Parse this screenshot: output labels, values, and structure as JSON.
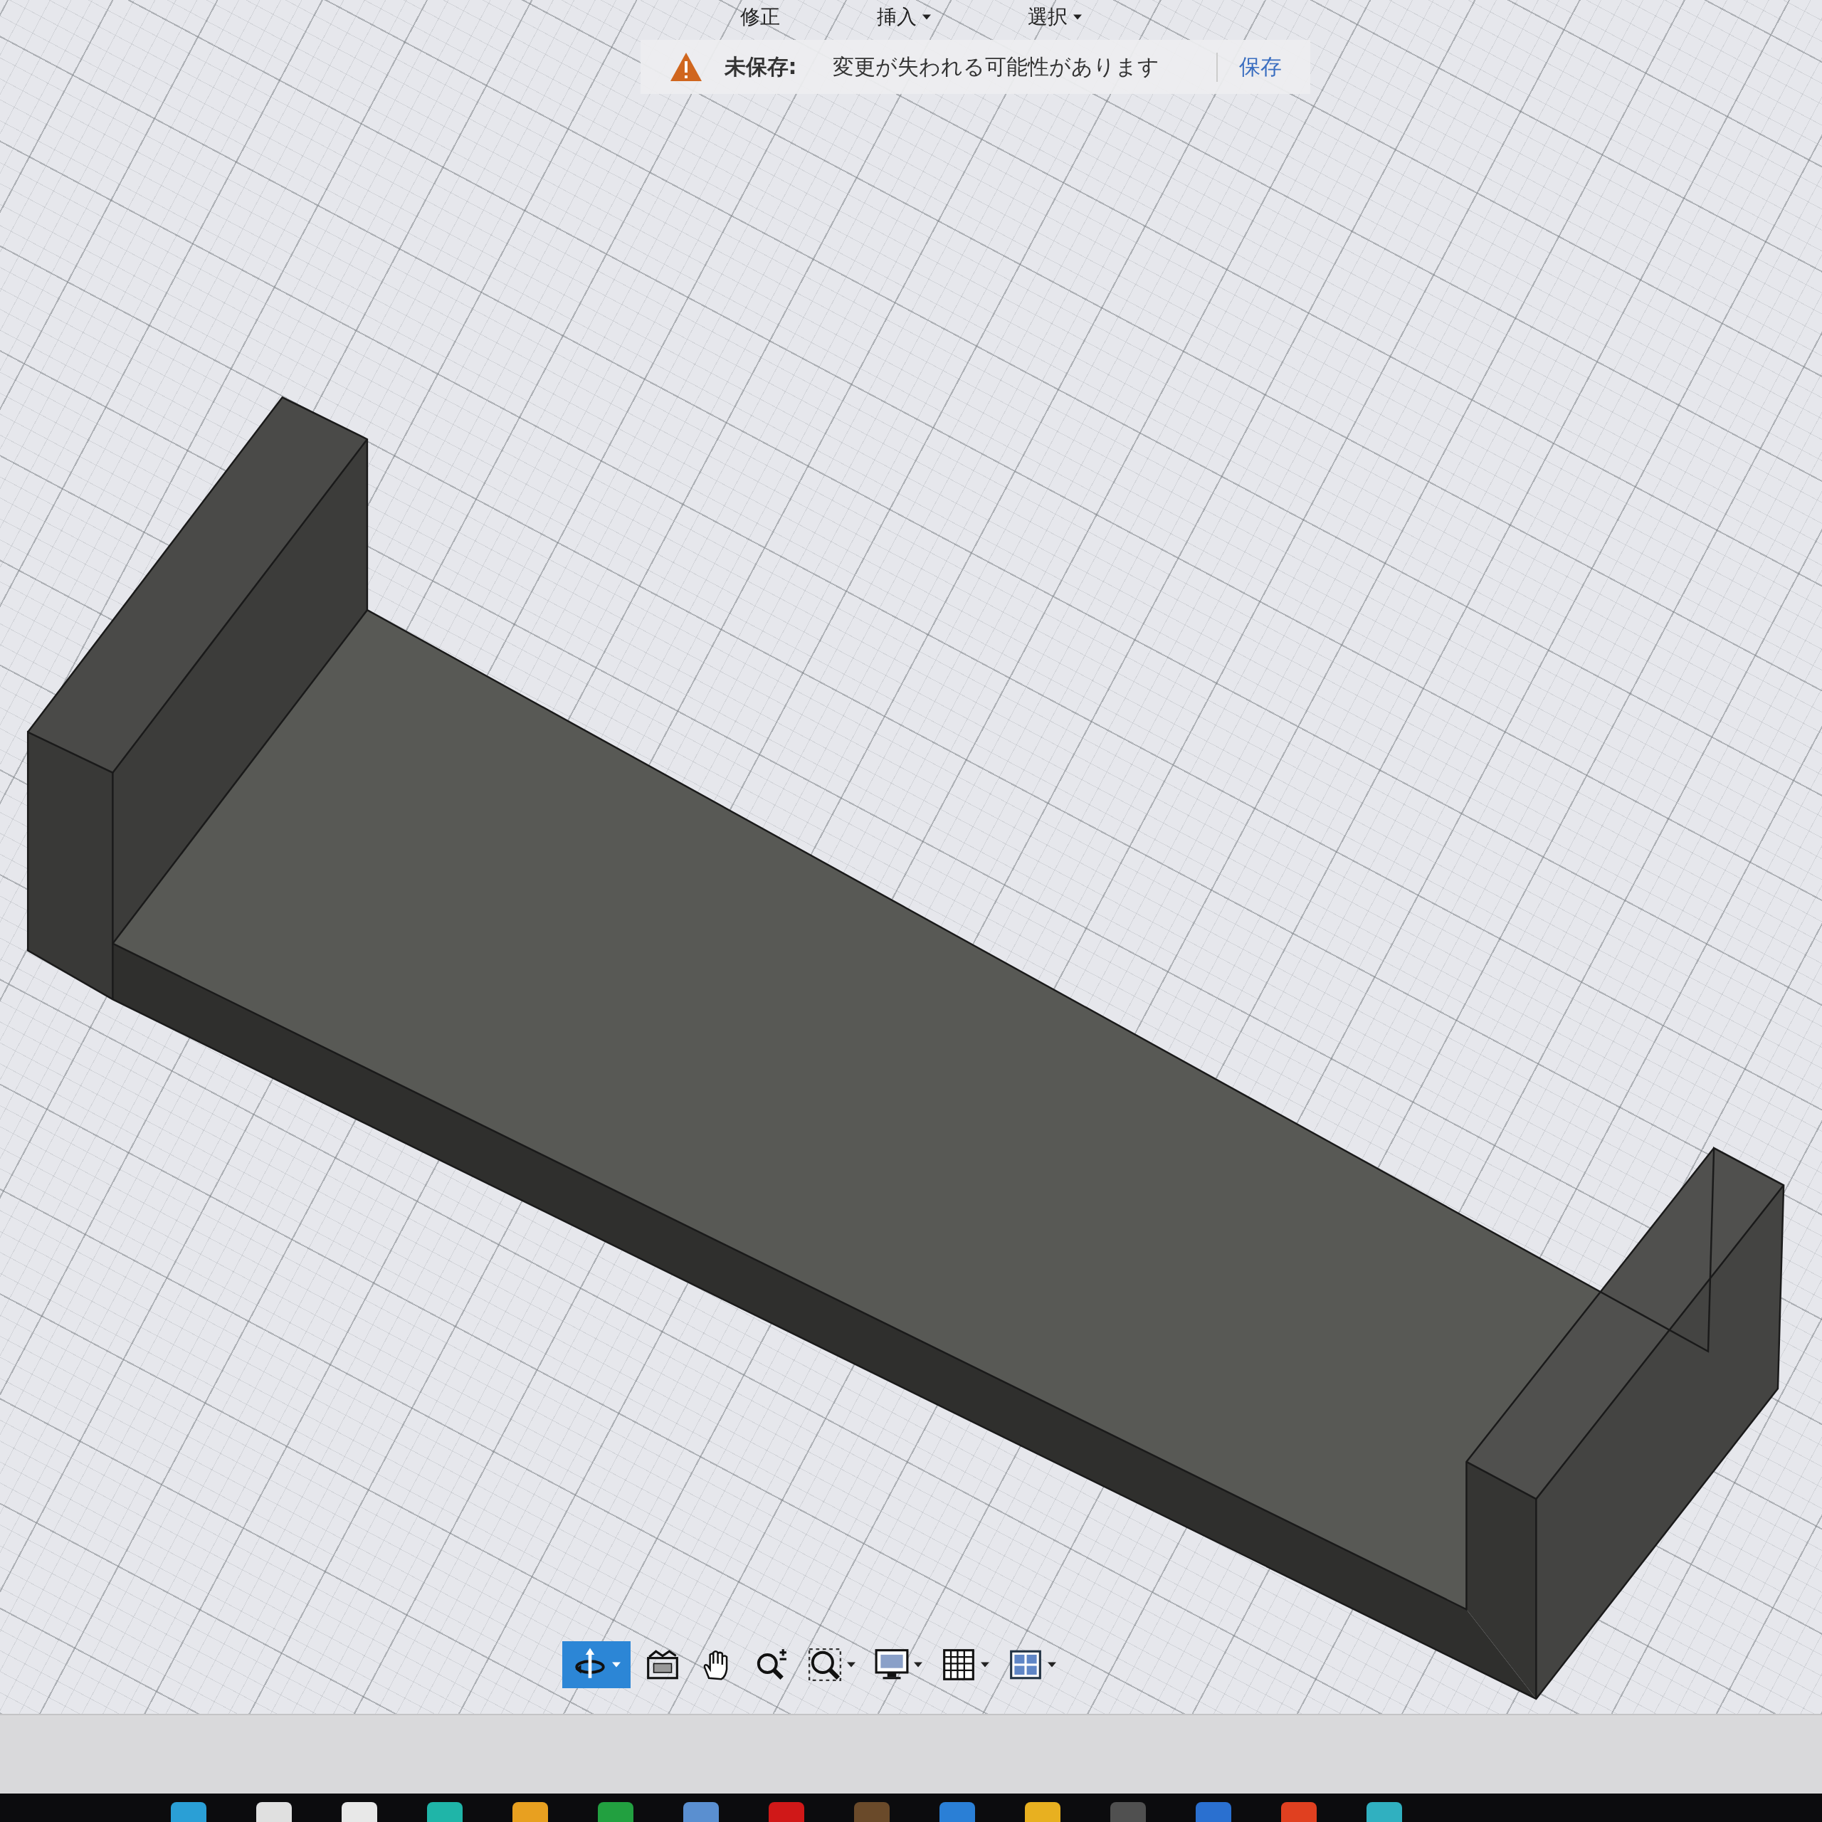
{
  "menu": [
    {
      "label": "修正",
      "dropdown": false
    },
    {
      "label": "挿入",
      "dropdown": true
    },
    {
      "label": "選択",
      "dropdown": true
    }
  ],
  "notice": {
    "title": "未保存:",
    "message": "変更が失われる可能性があります",
    "action": "保存"
  },
  "toolbar": [
    {
      "kind": "orbit",
      "selected": true,
      "dropdown": true
    },
    {
      "kind": "look",
      "selected": false,
      "dropdown": false
    },
    {
      "kind": "pan",
      "selected": false,
      "dropdown": false
    },
    {
      "kind": "zoom",
      "selected": false,
      "dropdown": false
    },
    {
      "kind": "fit",
      "selected": false,
      "dropdown": true
    },
    {
      "kind": "display",
      "selected": false,
      "dropdown": true
    },
    {
      "kind": "grid",
      "selected": false,
      "dropdown": true
    },
    {
      "kind": "viewports",
      "selected": false,
      "dropdown": true
    }
  ],
  "taskbar": [
    {
      "color": "#2a9fd6"
    },
    {
      "color": "#e0e0e0"
    },
    {
      "color": "#e8e8e8"
    },
    {
      "color": "#1fb5a8"
    },
    {
      "color": "#e8a020"
    },
    {
      "color": "#22a040"
    },
    {
      "color": "#5a8fd0"
    },
    {
      "color": "#d01818"
    },
    {
      "color": "#6a4a2a"
    },
    {
      "color": "#2a7fd6"
    },
    {
      "color": "#e8b020"
    },
    {
      "color": "#505050"
    },
    {
      "color": "#2a70d0"
    },
    {
      "color": "#e04020"
    },
    {
      "color": "#30b0c0"
    }
  ]
}
